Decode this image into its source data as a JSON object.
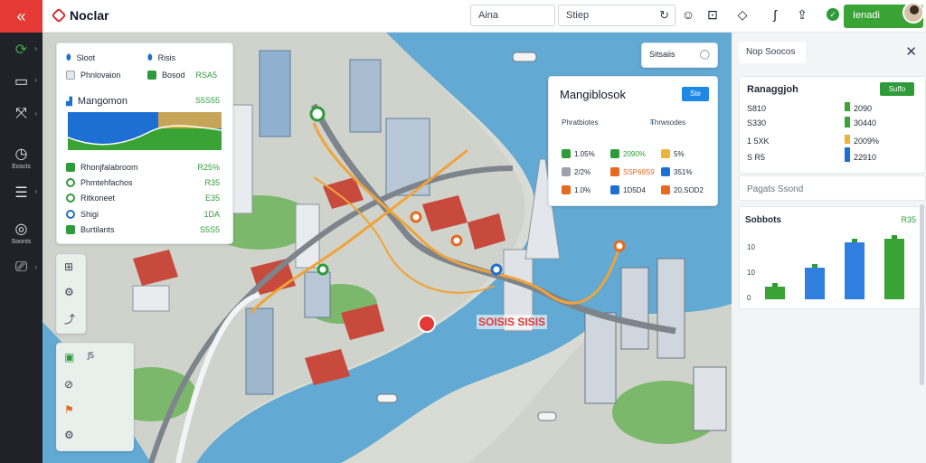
{
  "app": {
    "title": "Noclar"
  },
  "header": {
    "search_primary": "Aina",
    "search_secondary": "Stiep",
    "action_label": "Ienadi"
  },
  "sidebar": {
    "items": [
      {
        "icon": "sync-icon",
        "label": ""
      },
      {
        "icon": "layers-icon",
        "label": ""
      },
      {
        "icon": "route-icon",
        "label": ""
      },
      {
        "icon": "clock-icon",
        "label": "Eoscis"
      },
      {
        "icon": "list-icon",
        "label": ""
      },
      {
        "icon": "target-icon",
        "label": "Soonts"
      },
      {
        "icon": "drive-icon",
        "label": ""
      }
    ]
  },
  "left_panel": {
    "top": [
      {
        "label": "Sloot",
        "icon": "pin-icon"
      },
      {
        "label": "Risis",
        "icon": "pin-icon"
      },
      {
        "label": "Phnlovaion",
        "icon": "square-icon"
      },
      {
        "label": "Bosod",
        "value": "RSA5"
      }
    ],
    "section_title": "Mangomon",
    "section_value": "S5S55",
    "rows": [
      {
        "label": "Rhonjfalabroom",
        "value": "R25%"
      },
      {
        "label": "Phmtehfachos",
        "value": "R35"
      },
      {
        "label": "Ritkoneet",
        "value": "E35"
      },
      {
        "label": "Shigi",
        "value": "1DA"
      },
      {
        "label": "Burtilants",
        "value": "S5S5"
      }
    ]
  },
  "status_chip": {
    "label": "Sitsaiis"
  },
  "mid_panel": {
    "title": "Mangiblosok",
    "chip": "Ste",
    "columns": [
      "Phratbiotes",
      "Thrwsodes"
    ],
    "rows": [
      [
        "1.05%",
        "2090%",
        "5%"
      ],
      [
        "2/2%",
        "SSP69S9",
        "351%"
      ],
      [
        "1.0%",
        "1D5D4",
        "20,SOD2"
      ]
    ]
  },
  "map": {
    "sign": "SOISIS SISIS"
  },
  "right_panel": {
    "header": "Nop Soocos",
    "card1": {
      "title": "Ranaggjoh",
      "button": "Suffo",
      "rows": [
        {
          "left": "S810",
          "right": "2090"
        },
        {
          "left": "S330",
          "right": "30440"
        },
        {
          "left": "1 5XK",
          "right": "2009%"
        },
        {
          "left": "S R5",
          "right": "22910"
        }
      ]
    },
    "card2": {
      "label": "Pagats Ssond"
    },
    "card3": {
      "title": "Sobbots",
      "total": "R35",
      "axis": [
        "10",
        "10",
        "0"
      ]
    }
  },
  "chart_data": {
    "type": "bar",
    "title": "Sobbots",
    "categories": [
      "",
      "",
      "",
      ""
    ],
    "values": [
      4,
      10,
      18,
      19
    ],
    "ylim": [
      0,
      20
    ],
    "legend": "none"
  },
  "colors": {
    "accent_red": "#e53935",
    "brand_green": "#3aa335",
    "chart_blue": "#2f7ee0",
    "chart_green": "#3aa335",
    "water": "#62a9d3"
  }
}
